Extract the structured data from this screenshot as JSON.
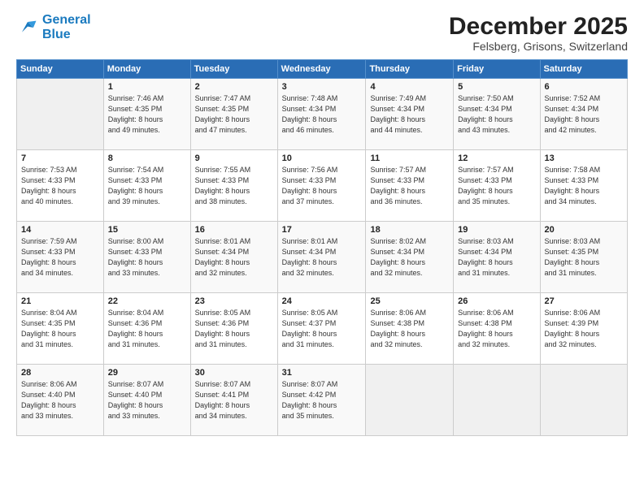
{
  "logo": {
    "line1": "General",
    "line2": "Blue"
  },
  "title": "December 2025",
  "subtitle": "Felsberg, Grisons, Switzerland",
  "weekdays": [
    "Sunday",
    "Monday",
    "Tuesday",
    "Wednesday",
    "Thursday",
    "Friday",
    "Saturday"
  ],
  "weeks": [
    [
      {
        "day": "",
        "info": ""
      },
      {
        "day": "1",
        "info": "Sunrise: 7:46 AM\nSunset: 4:35 PM\nDaylight: 8 hours\nand 49 minutes."
      },
      {
        "day": "2",
        "info": "Sunrise: 7:47 AM\nSunset: 4:35 PM\nDaylight: 8 hours\nand 47 minutes."
      },
      {
        "day": "3",
        "info": "Sunrise: 7:48 AM\nSunset: 4:34 PM\nDaylight: 8 hours\nand 46 minutes."
      },
      {
        "day": "4",
        "info": "Sunrise: 7:49 AM\nSunset: 4:34 PM\nDaylight: 8 hours\nand 44 minutes."
      },
      {
        "day": "5",
        "info": "Sunrise: 7:50 AM\nSunset: 4:34 PM\nDaylight: 8 hours\nand 43 minutes."
      },
      {
        "day": "6",
        "info": "Sunrise: 7:52 AM\nSunset: 4:34 PM\nDaylight: 8 hours\nand 42 minutes."
      }
    ],
    [
      {
        "day": "7",
        "info": "Sunrise: 7:53 AM\nSunset: 4:33 PM\nDaylight: 8 hours\nand 40 minutes."
      },
      {
        "day": "8",
        "info": "Sunrise: 7:54 AM\nSunset: 4:33 PM\nDaylight: 8 hours\nand 39 minutes."
      },
      {
        "day": "9",
        "info": "Sunrise: 7:55 AM\nSunset: 4:33 PM\nDaylight: 8 hours\nand 38 minutes."
      },
      {
        "day": "10",
        "info": "Sunrise: 7:56 AM\nSunset: 4:33 PM\nDaylight: 8 hours\nand 37 minutes."
      },
      {
        "day": "11",
        "info": "Sunrise: 7:57 AM\nSunset: 4:33 PM\nDaylight: 8 hours\nand 36 minutes."
      },
      {
        "day": "12",
        "info": "Sunrise: 7:57 AM\nSunset: 4:33 PM\nDaylight: 8 hours\nand 35 minutes."
      },
      {
        "day": "13",
        "info": "Sunrise: 7:58 AM\nSunset: 4:33 PM\nDaylight: 8 hours\nand 34 minutes."
      }
    ],
    [
      {
        "day": "14",
        "info": "Sunrise: 7:59 AM\nSunset: 4:33 PM\nDaylight: 8 hours\nand 34 minutes."
      },
      {
        "day": "15",
        "info": "Sunrise: 8:00 AM\nSunset: 4:33 PM\nDaylight: 8 hours\nand 33 minutes."
      },
      {
        "day": "16",
        "info": "Sunrise: 8:01 AM\nSunset: 4:34 PM\nDaylight: 8 hours\nand 32 minutes."
      },
      {
        "day": "17",
        "info": "Sunrise: 8:01 AM\nSunset: 4:34 PM\nDaylight: 8 hours\nand 32 minutes."
      },
      {
        "day": "18",
        "info": "Sunrise: 8:02 AM\nSunset: 4:34 PM\nDaylight: 8 hours\nand 32 minutes."
      },
      {
        "day": "19",
        "info": "Sunrise: 8:03 AM\nSunset: 4:34 PM\nDaylight: 8 hours\nand 31 minutes."
      },
      {
        "day": "20",
        "info": "Sunrise: 8:03 AM\nSunset: 4:35 PM\nDaylight: 8 hours\nand 31 minutes."
      }
    ],
    [
      {
        "day": "21",
        "info": "Sunrise: 8:04 AM\nSunset: 4:35 PM\nDaylight: 8 hours\nand 31 minutes."
      },
      {
        "day": "22",
        "info": "Sunrise: 8:04 AM\nSunset: 4:36 PM\nDaylight: 8 hours\nand 31 minutes."
      },
      {
        "day": "23",
        "info": "Sunrise: 8:05 AM\nSunset: 4:36 PM\nDaylight: 8 hours\nand 31 minutes."
      },
      {
        "day": "24",
        "info": "Sunrise: 8:05 AM\nSunset: 4:37 PM\nDaylight: 8 hours\nand 31 minutes."
      },
      {
        "day": "25",
        "info": "Sunrise: 8:06 AM\nSunset: 4:38 PM\nDaylight: 8 hours\nand 32 minutes."
      },
      {
        "day": "26",
        "info": "Sunrise: 8:06 AM\nSunset: 4:38 PM\nDaylight: 8 hours\nand 32 minutes."
      },
      {
        "day": "27",
        "info": "Sunrise: 8:06 AM\nSunset: 4:39 PM\nDaylight: 8 hours\nand 32 minutes."
      }
    ],
    [
      {
        "day": "28",
        "info": "Sunrise: 8:06 AM\nSunset: 4:40 PM\nDaylight: 8 hours\nand 33 minutes."
      },
      {
        "day": "29",
        "info": "Sunrise: 8:07 AM\nSunset: 4:40 PM\nDaylight: 8 hours\nand 33 minutes."
      },
      {
        "day": "30",
        "info": "Sunrise: 8:07 AM\nSunset: 4:41 PM\nDaylight: 8 hours\nand 34 minutes."
      },
      {
        "day": "31",
        "info": "Sunrise: 8:07 AM\nSunset: 4:42 PM\nDaylight: 8 hours\nand 35 minutes."
      },
      {
        "day": "",
        "info": ""
      },
      {
        "day": "",
        "info": ""
      },
      {
        "day": "",
        "info": ""
      }
    ]
  ]
}
